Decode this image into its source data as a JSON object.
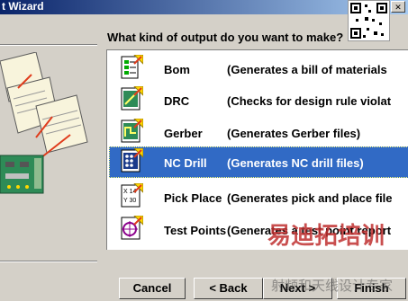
{
  "window": {
    "title": "t Wizard"
  },
  "question": "What kind of output do you want to make?",
  "options": [
    {
      "name": "Bom",
      "description": "(Generates a bill of materials",
      "icon": "bom-icon",
      "selected": false
    },
    {
      "name": "DRC",
      "description": "(Checks for design rule violat",
      "icon": "drc-icon",
      "selected": false
    },
    {
      "name": "Gerber",
      "description": "(Generates Gerber files)",
      "icon": "gerber-icon",
      "selected": false
    },
    {
      "name": "NC Drill",
      "description": "(Generates NC drill files)",
      "icon": "nc-drill-icon",
      "selected": true
    },
    {
      "name": "Pick Place",
      "description": "(Generates pick and place file",
      "icon": "pick-place-icon",
      "selected": false
    },
    {
      "name": "Test Points",
      "description": "(Generates a test point report",
      "icon": "test-points-icon",
      "selected": false
    }
  ],
  "buttons": {
    "cancel": "Cancel",
    "back": "< Back",
    "next": "Next >",
    "finish": "Finish"
  },
  "watermark": {
    "text": "易迪拓培训",
    "subtext": "射频和天线设计专家"
  },
  "colors": {
    "selection": "#316ac5",
    "title_start": "#0a246a",
    "title_end": "#a6caf0",
    "face": "#d4d0c8"
  }
}
